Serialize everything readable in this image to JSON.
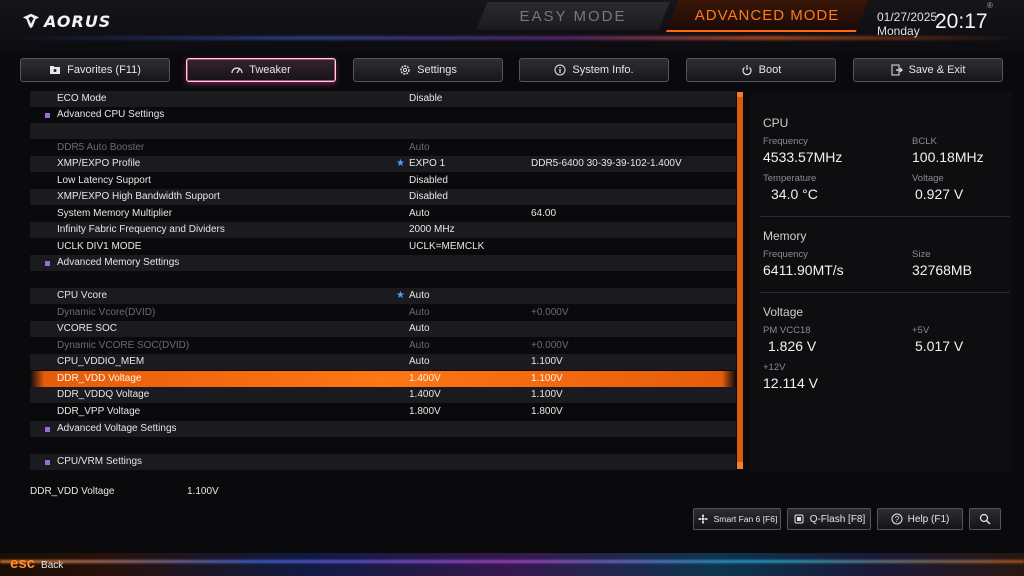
{
  "brand": {
    "logo_text": "AORUS"
  },
  "modes": {
    "easy": "EASY MODE",
    "advanced": "ADVANCED MODE"
  },
  "clock": {
    "date": "01/27/2025",
    "day": "Monday",
    "time": "20:17",
    "reg_mark": "®"
  },
  "tabs": [
    {
      "label": "Favorites (F11)",
      "icon": "folder-star-icon"
    },
    {
      "label": "Tweaker",
      "icon": "speedometer-icon"
    },
    {
      "label": "Settings",
      "icon": "gear-icon"
    },
    {
      "label": "System Info.",
      "icon": "info-icon"
    },
    {
      "label": "Boot",
      "icon": "power-icon"
    },
    {
      "label": "Save & Exit",
      "icon": "exit-icon"
    }
  ],
  "rows": [
    {
      "label": "ECO Mode",
      "v1": "Disable",
      "v2": ""
    },
    {
      "label": "Advanced CPU Settings",
      "v1": "",
      "v2": ""
    },
    {
      "label": "",
      "v1": "",
      "v2": ""
    },
    {
      "label": "DDR5 Auto Booster",
      "v1": "Auto",
      "v2": ""
    },
    {
      "label": "XMP/EXPO Profile",
      "v1": "EXPO 1",
      "v2": "DDR5-6400 30-39-39-102-1.400V"
    },
    {
      "label": "Low Latency Support",
      "v1": "Disabled",
      "v2": ""
    },
    {
      "label": "XMP/EXPO High Bandwidth Support",
      "v1": "Disabled",
      "v2": ""
    },
    {
      "label": "System Memory Multiplier",
      "v1": "Auto",
      "v2": "64.00"
    },
    {
      "label": "Infinity Fabric Frequency and Dividers",
      "v1": "2000 MHz",
      "v2": ""
    },
    {
      "label": "UCLK DIV1 MODE",
      "v1": "UCLK=MEMCLK",
      "v2": ""
    },
    {
      "label": "Advanced Memory Settings",
      "v1": "",
      "v2": ""
    },
    {
      "label": "",
      "v1": "",
      "v2": ""
    },
    {
      "label": "CPU Vcore",
      "v1": "Auto",
      "v2": ""
    },
    {
      "label": "Dynamic Vcore(DVID)",
      "v1": "Auto",
      "v2": "+0.000V"
    },
    {
      "label": "VCORE SOC",
      "v1": "Auto",
      "v2": ""
    },
    {
      "label": "Dynamic VCORE SOC(DVID)",
      "v1": "Auto",
      "v2": "+0.000V"
    },
    {
      "label": "CPU_VDDIO_MEM",
      "v1": "Auto",
      "v2": "1.100V"
    },
    {
      "label": "DDR_VDD Voltage",
      "v1": "1.400V",
      "v2": "1.100V"
    },
    {
      "label": "DDR_VDDQ Voltage",
      "v1": "1.400V",
      "v2": "1.100V"
    },
    {
      "label": "DDR_VPP Voltage",
      "v1": "1.800V",
      "v2": "1.800V"
    },
    {
      "label": "Advanced Voltage Settings",
      "v1": "",
      "v2": ""
    },
    {
      "label": "",
      "v1": "",
      "v2": ""
    },
    {
      "label": "CPU/VRM Settings",
      "v1": "",
      "v2": ""
    }
  ],
  "monitor": {
    "cpu": {
      "title": "CPU",
      "freq_label": "Frequency",
      "freq": "4533.57MHz",
      "bclk_label": "BCLK",
      "bclk": "100.18MHz",
      "temp_label": "Temperature",
      "temp": "34.0 °C",
      "volt_label": "Voltage",
      "volt": "0.927 V"
    },
    "memory": {
      "title": "Memory",
      "freq_label": "Frequency",
      "freq": "6411.90MT/s",
      "size_label": "Size",
      "size": "32768MB"
    },
    "voltage": {
      "title": "Voltage",
      "vcc18_label": "PM VCC18",
      "vcc18": "1.826 V",
      "p5v_label": "+5V",
      "p5v": "5.017 V",
      "p12v_label": "+12V",
      "p12v": "12.114 V"
    }
  },
  "status": {
    "label": "DDR_VDD Voltage",
    "value": "1.100V"
  },
  "bottom_buttons": {
    "smartfan": "Smart Fan 6 [F6]",
    "qflash": "Q-Flash [F8]",
    "help": "Help (F1)"
  },
  "esc": {
    "key": "esc",
    "label": "Back"
  }
}
